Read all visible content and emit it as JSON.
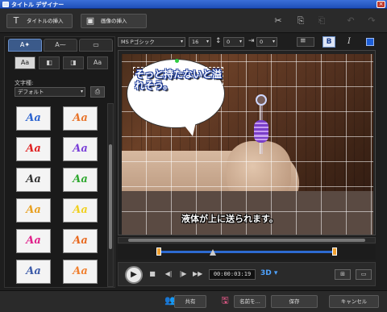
{
  "window": {
    "title": "タイトル デザイナー",
    "close": "×"
  },
  "toolbar": {
    "insert_title": "タイトルの挿入",
    "insert_image": "画像の挿入",
    "insert_title_icon": "T",
    "insert_image_icon": "▣",
    "cut_icon": "✂",
    "copy_icon": "⎘",
    "paste_icon": "⎗",
    "undo_icon": "↶",
    "redo_icon": "↷"
  },
  "left_panel": {
    "tabs": [
      {
        "label": "A✦",
        "icon": "text-effects-icon"
      },
      {
        "label": "A⁓",
        "icon": "motion-icon"
      },
      {
        "label": "▭",
        "icon": "background-icon"
      }
    ],
    "text_styles": [
      {
        "label": "Aa"
      },
      {
        "label": "◧"
      },
      {
        "label": "◨"
      },
      {
        "label": "Aa"
      }
    ],
    "text_type_label": "文字種:",
    "text_type_value": "デフォルト",
    "text_type_arrow": "▾",
    "save_preset_icon": "⎙",
    "presets": [
      {
        "label": "Aa",
        "color": "#2b63d0"
      },
      {
        "label": "Aa",
        "color": "#e8742a"
      },
      {
        "label": "Aa",
        "color": "#e02020"
      },
      {
        "label": "Aa",
        "color": "#7a3fd8"
      },
      {
        "label": "Aa",
        "color": "#333333"
      },
      {
        "label": "Aa",
        "color": "#2fa82f"
      },
      {
        "label": "Aa",
        "color": "#e8a020"
      },
      {
        "label": "Aa",
        "color": "#f0d020"
      },
      {
        "label": "Aa",
        "color": "#e0208a"
      },
      {
        "label": "Aa",
        "color": "#e86a20"
      },
      {
        "label": "Aa",
        "color": "#3b5aa8"
      },
      {
        "label": "Aa",
        "color": "#f08030"
      }
    ]
  },
  "format_bar": {
    "font": "MS Pゴシック",
    "font_size": "16",
    "line_spacing": "0",
    "char_spacing": "0",
    "align_icon": "≡",
    "bold": "B",
    "italic": "I",
    "arrow": "▾",
    "spacing_icon": "↕",
    "kerning_icon": "⇥",
    "text_color": "#1e5fd8"
  },
  "preview": {
    "caption1": "そっと持たないと溢れそう。",
    "caption2": "液体が上に送られます。"
  },
  "playback": {
    "play": "▶",
    "stop": "■",
    "prev": "◀|",
    "next": "|▶",
    "ffwd": "▶▶",
    "timecode": "00:00:03:19",
    "mode": "3D",
    "mode_arrow": "▾",
    "safe_area_icon": "⊞",
    "aspect_icon": "▭"
  },
  "bottom": {
    "share_icon": "👥",
    "share": "共有",
    "save_as_icon": "🖫",
    "save_as": "名前を...",
    "save": "保存",
    "cancel": "キャンセル"
  }
}
